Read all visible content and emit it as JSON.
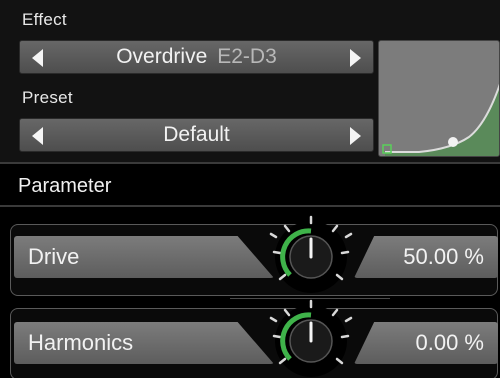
{
  "effect": {
    "label": "Effect",
    "name": "Overdrive",
    "range": "E2-D3"
  },
  "preset": {
    "label": "Preset",
    "name": "Default"
  },
  "parameter_section": {
    "title": "Parameter"
  },
  "parameters": [
    {
      "label": "Drive",
      "value": "50.00 %",
      "level": 0.5
    },
    {
      "label": "Harmonics",
      "value": "0.00 %",
      "level": 0.0
    }
  ],
  "colors": {
    "accent_green": "#3fb34a",
    "curve_fill": "#5a8a5a"
  }
}
